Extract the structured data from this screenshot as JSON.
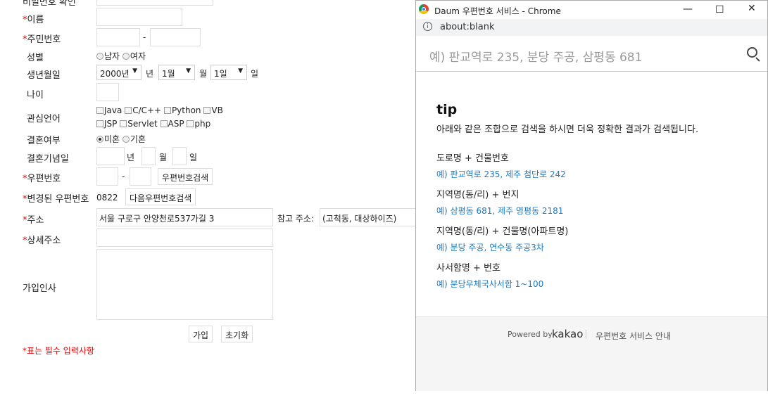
{
  "form": {
    "top_cut_label": "비밀번호 확인",
    "labels": {
      "name": "이름",
      "jumin": "주민번호",
      "gender": "성별",
      "birth": "생년월일",
      "age": "나이",
      "interest": "관심언어",
      "married": "결혼여부",
      "anniversary": "결혼기념일",
      "zipcode": "우편번호",
      "changed_zip": "변경된 우편번호",
      "address": "주소",
      "detail_address": "상세주소",
      "greeting": "가입인사"
    },
    "required_mark": "*",
    "jumin_sep": "-",
    "gender_options": [
      "남자",
      "여자"
    ],
    "birth": {
      "year": "2000년",
      "year_unit": "년",
      "month": "1월",
      "month_unit": "월",
      "day": "1일",
      "day_unit": "일"
    },
    "languages_row1": [
      "Java",
      "C/C++",
      "Python",
      "VB"
    ],
    "languages_row2": [
      "JSP",
      "Servlet",
      "ASP",
      "php"
    ],
    "married_options": [
      "미혼",
      "기혼"
    ],
    "anniv_units": {
      "year": "년",
      "month": "월",
      "day": "일"
    },
    "zip_sep": "-",
    "zip_search_button": "우편번호검색",
    "changed_zip_value": "0822",
    "daum_zip_button": "다음우편번호검색",
    "address_value": "서울 구로구 안양천로537가길 3",
    "ref_label": "참고 주소:",
    "ref_value": "(고척동, 대상하이즈)",
    "join_button": "가입",
    "reset_button": "초기화",
    "footnote": "*표는 필수 입력사항"
  },
  "popup": {
    "window_title": "Daum 우편번호 서비스 - Chrome",
    "url": "about:blank",
    "search_placeholder": "예) 판교역로 235, 분당 주공, 삼평동 681",
    "tip_title": "tip",
    "tip_desc": "아래와 같은 조합으로 검색을 하시면 더욱 정확한 결과가 검색됩니다.",
    "sections": [
      {
        "title": "도로명 + 건물번호",
        "example": "예) 판교역로 235,  제주 첨단로 242"
      },
      {
        "title": "지역명(동/리) + 번지",
        "example": "예) 삼평동 681,  제주 영평동 2181"
      },
      {
        "title": "지역명(동/리) + 건물명(아파트명)",
        "example": "예) 분당 주공,  연수동 주공3차"
      },
      {
        "title": "사서함명 + 번호",
        "example": "예) 분당우체국사서함 1~100"
      }
    ],
    "powered_by": "Powered by",
    "brand": "kakao",
    "service_guide": "우편번호 서비스 안내"
  }
}
